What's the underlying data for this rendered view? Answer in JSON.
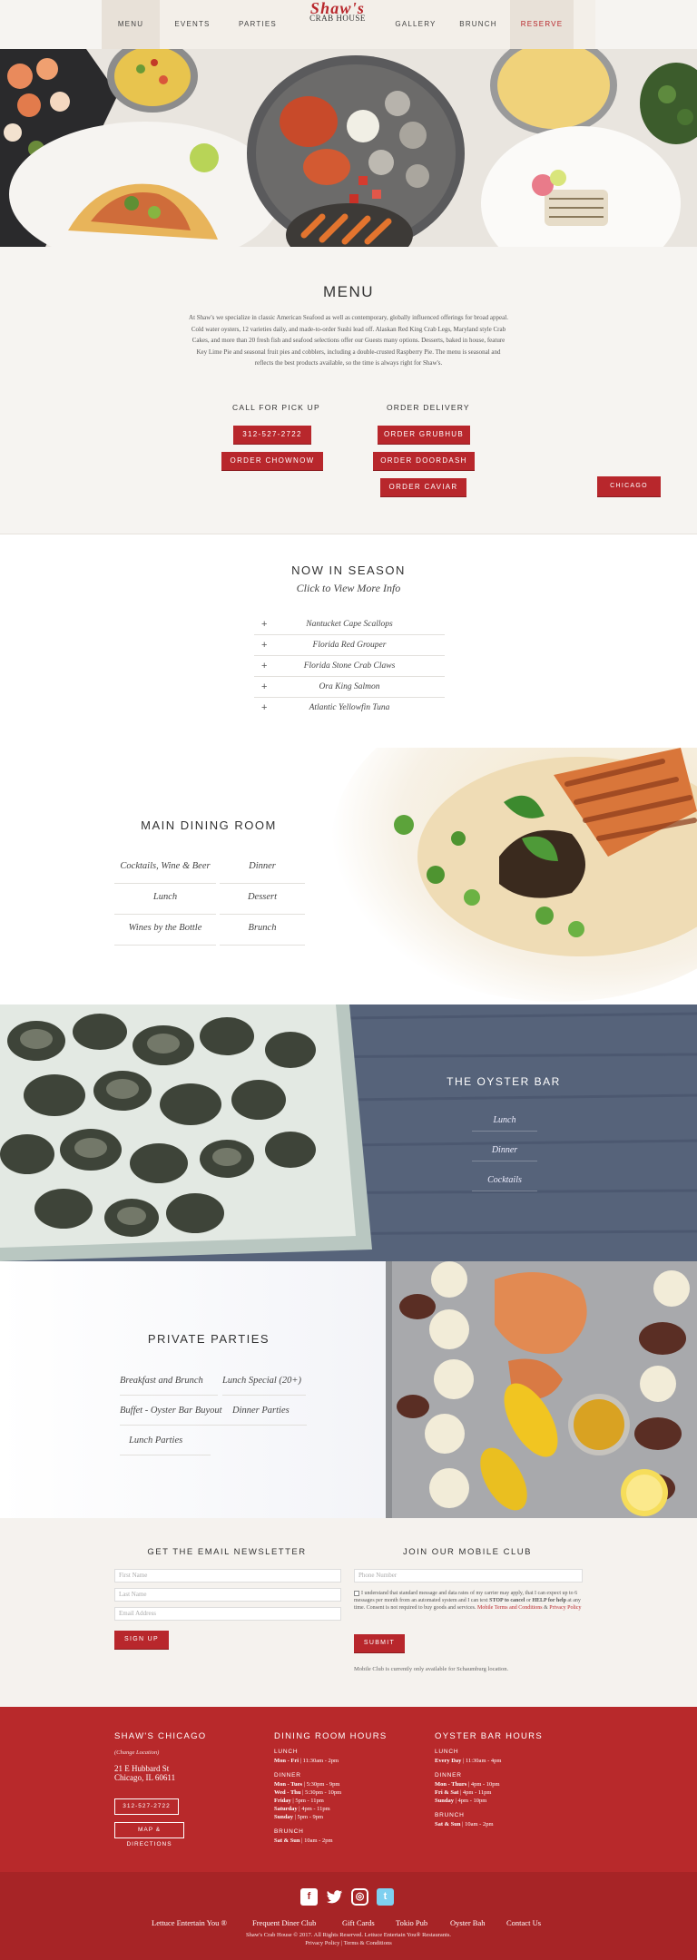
{
  "nav": {
    "menu": "MENU",
    "events": "EVENTS",
    "parties": "PARTIES",
    "logo_script": "Shaw's",
    "logo_sub": "CRAB HOUSE",
    "gallery": "GALLERY",
    "brunch": "BRUNCH",
    "reserve": "RESERVE"
  },
  "menu": {
    "title": "MENU",
    "description": "At Shaw's we specialize in classic American Seafood as well as contemporary, globally influenced offerings for broad appeal. Cold water oysters, 12 varieties daily, and made-to-order Sushi lead off. Alaskan Red King Crab Legs, Maryland style Crab Cakes, and more than 20 fresh fish and seafood selections offer our Guests many options. Desserts, baked in house, feature Key Lime Pie and seasonal fruit pies and cobblers, including a double-crusted Raspberry Pie. The menu is seasonal and reflects the best products available, so the time is always right for Shaw's.",
    "pickup_label": "CALL FOR PICK UP",
    "delivery_label": "ORDER DELIVERY",
    "phone_btn": "312-527-2722",
    "chownow_btn": "ORDER CHOWNOW",
    "grubhub_btn": "ORDER GRUBHUB",
    "doordash_btn": "ORDER DOORDASH",
    "caviar_btn": "ORDER CAVIAR",
    "chicago_btn": "CHICAGO"
  },
  "season": {
    "title": "NOW IN SEASON",
    "subtitle": "Click to View More Info",
    "items": [
      "Nantucket Cape Scallops",
      "Florida Red Grouper",
      "Florida Stone Crab Claws",
      "Ora King Salmon",
      "Atlantic Yellowfin Tuna"
    ],
    "plus": "+"
  },
  "dining": {
    "title": "MAIN DINING ROOM",
    "items": [
      "Cocktails, Wine & Beer",
      "Dinner",
      "Lunch",
      "Dessert",
      "Wines by the Bottle",
      "Brunch"
    ]
  },
  "oyster": {
    "title": "THE OYSTER BAR",
    "items": [
      "Lunch",
      "Dinner",
      "Cocktails"
    ]
  },
  "parties": {
    "title": "PRIVATE PARTIES",
    "items": [
      "Breakfast and Brunch",
      "Lunch Special (20+)",
      "Buffet - Oyster Bar Buyout",
      "Dinner Parties",
      "Lunch Parties"
    ]
  },
  "newsletter": {
    "title": "GET THE EMAIL NEWSLETTER",
    "first_name": "First Name",
    "last_name": "Last Name",
    "email": "Email Address",
    "signup": "SIGN UP"
  },
  "mobile": {
    "title": "JOIN OUR MOBILE CLUB",
    "phone": "Phone Number",
    "consent_a": "I understand that standard message and data rates of my carrier may apply, that I can expect up to 6 messages per month from an automated system and I can text ",
    "consent_stop": "STOP to cancel",
    "consent_b": " or ",
    "consent_help": "HELP for help",
    "consent_c": " at any time. Consent is not required to buy goods and services. ",
    "consent_terms": "Mobile Terms and Conditions",
    "consent_amp": " & ",
    "consent_privacy": "Privacy Policy",
    "submit": "SUBMIT",
    "note": "Mobile Club is currently only available for Schaumburg location."
  },
  "footer": {
    "location_title": "SHAW'S CHICAGO",
    "change_location": "(Change Location)",
    "address1": "21 E Hubbard St",
    "address2": "Chicago, IL 60611",
    "phone_btn": "312-527-2722",
    "map_btn": "MAP & DIRECTIONS",
    "dining_title": "DINING ROOM HOURS",
    "dining_lunch": "LUNCH",
    "dining_lunch_days": "Mon - Fri",
    "dining_lunch_time": " | 11:30am - 2pm",
    "dining_dinner": "DINNER",
    "dining_d1_days": "Mon - Tues",
    "dining_d1_time": " | 5:30pm - 9pm",
    "dining_d2_days": "Wed - Thu",
    "dining_d2_time": " | 5:30pm - 10pm",
    "dining_d3_days": "Friday",
    "dining_d3_time": " | 5pm - 11pm",
    "dining_d4_days": "Saturday",
    "dining_d4_time": " | 4pm - 11pm",
    "dining_d5_days": "Sunday",
    "dining_d5_time": " | 5pm - 9pm",
    "dining_brunch": "BRUNCH",
    "dining_brunch_days": "Sat & Sun",
    "dining_brunch_time": " | 10am - 2pm",
    "oyster_title": "OYSTER BAR HOURS",
    "oyster_lunch": "LUNCH",
    "oyster_lunch_days": "Every Day",
    "oyster_lunch_time": " | 11:30am - 4pm",
    "oyster_dinner": "DINNER",
    "oyster_d1_days": "Mon - Thurs",
    "oyster_d1_time": " | 4pm - 10pm",
    "oyster_d2_days": "Fri & Sat",
    "oyster_d2_time": " | 4pm - 11pm",
    "oyster_d3_days": "Sunday",
    "oyster_d3_time": " | 4pm - 10pm",
    "oyster_brunch": "BRUNCH",
    "oyster_brunch_days": "Sat & Sun",
    "oyster_brunch_time": " | 10am - 2pm"
  },
  "bottom": {
    "social": [
      "f",
      "t",
      "◎",
      "t"
    ],
    "links": [
      "Lettuce Entertain You ®",
      "Frequent Diner Club",
      "Gift Cards",
      "Tokio Pub",
      "Oyster Bah",
      "Contact Us"
    ],
    "copyright": "Shaw's Crab House © 2017. All Rights Reserved. Lettuce Entertain You® Restaurants.",
    "privacy": "Privacy Policy",
    "sep": " | ",
    "terms": "Terms & Conditions"
  },
  "colors": {
    "brand_red": "#b8272c",
    "footer_red": "#b8292b",
    "bottom_red": "#a72426",
    "nav_bg": "#f3efe9"
  }
}
